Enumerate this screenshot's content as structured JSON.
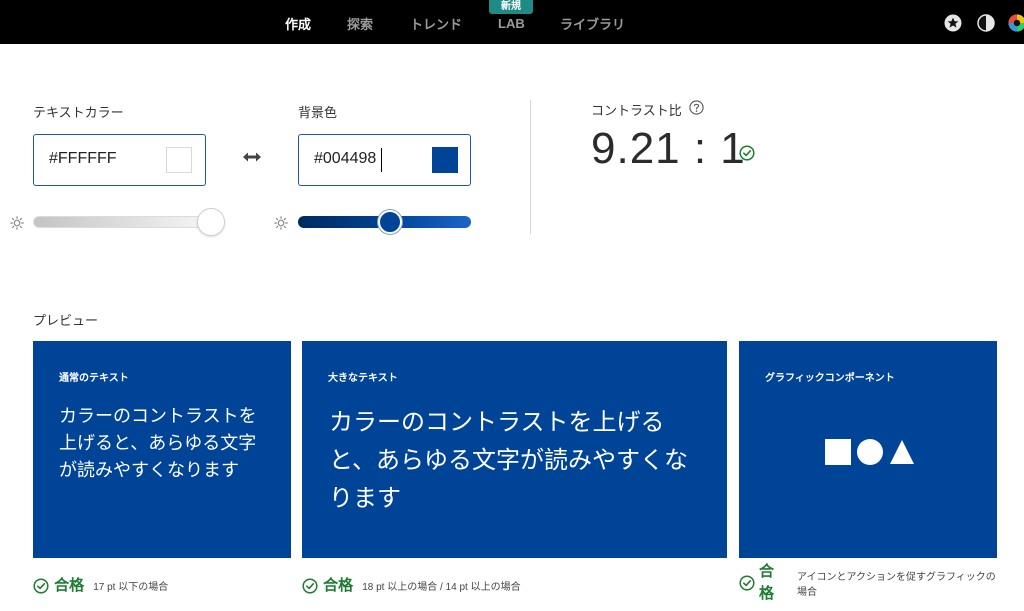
{
  "nav": {
    "items": [
      {
        "label": "作成",
        "active": true
      },
      {
        "label": "探索",
        "active": false
      },
      {
        "label": "トレンド",
        "active": false
      },
      {
        "label": "LAB",
        "active": false
      },
      {
        "label": "ライブラリ",
        "active": false
      }
    ],
    "new_badge": "新規",
    "icons": [
      "star-icon",
      "contrast-icon",
      "color-wheel-icon"
    ]
  },
  "text_color": {
    "label": "テキストカラー",
    "value": "#FFFFFF",
    "swatch_color": "#FFFFFF",
    "brightness": 1.0
  },
  "background_color": {
    "label": "背景色",
    "value": "#004498",
    "swatch_color": "#004498",
    "brightness": 0.53
  },
  "contrast": {
    "label": "コントラスト比",
    "ratio": "9.21 : 1"
  },
  "preview": {
    "label": "プレビュー",
    "cards": [
      {
        "title": "通常のテキスト",
        "body": "カラーのコントラストを上げると、あらゆる文字が読みやすくなります",
        "pass_label": "合格",
        "pass_note": "17 pt 以下の場合"
      },
      {
        "title": "大きなテキスト",
        "body": "カラーのコントラストを上げると、あらゆる文字が読みやすくなります",
        "pass_label": "合格",
        "pass_note": "18 pt 以上の場合 / 14 pt 以上の場合"
      },
      {
        "title": "グラフィックコンポーネント",
        "pass_label": "合格",
        "pass_note": "アイコンとアクションを促すグラフィックの場合"
      }
    ]
  },
  "colors": {
    "accent": "#004498",
    "pass_green": "#1e7d32",
    "badge": "#1e8c84"
  }
}
